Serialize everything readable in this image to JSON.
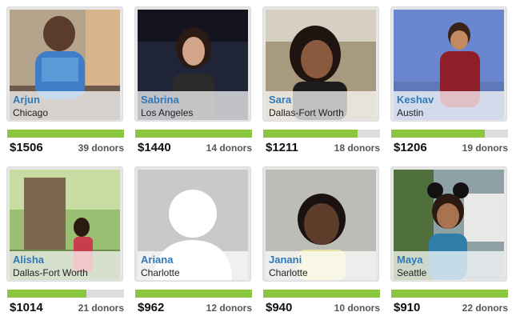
{
  "donors_label": "donors",
  "accent": "#8cc63f",
  "name_color": "#2e7ab8",
  "participants": [
    {
      "name": "Arjun",
      "city": "Chicago",
      "amount": "$1506",
      "donors": "39 donors",
      "progress": 1.0
    },
    {
      "name": "Sabrina",
      "city": "Los Angeles",
      "amount": "$1440",
      "donors": "14 donors",
      "progress": 1.0
    },
    {
      "name": "Sara",
      "city": "Dallas-Fort Worth",
      "amount": "$1211",
      "donors": "18 donors",
      "progress": 0.81
    },
    {
      "name": "Keshav",
      "city": "Austin",
      "amount": "$1206",
      "donors": "19 donors",
      "progress": 0.8
    },
    {
      "name": "Alisha",
      "city": "Dallas-Fort Worth",
      "amount": "$1014",
      "donors": "21 donors",
      "progress": 0.68
    },
    {
      "name": "Ariana",
      "city": "Charlotte",
      "amount": "$962",
      "donors": "12 donors",
      "progress": 1.0
    },
    {
      "name": "Janani",
      "city": "Charlotte",
      "amount": "$940",
      "donors": "10 donors",
      "progress": 1.0
    },
    {
      "name": "Maya",
      "city": "Seattle",
      "amount": "$910",
      "donors": "22 donors",
      "progress": 1.0
    }
  ]
}
